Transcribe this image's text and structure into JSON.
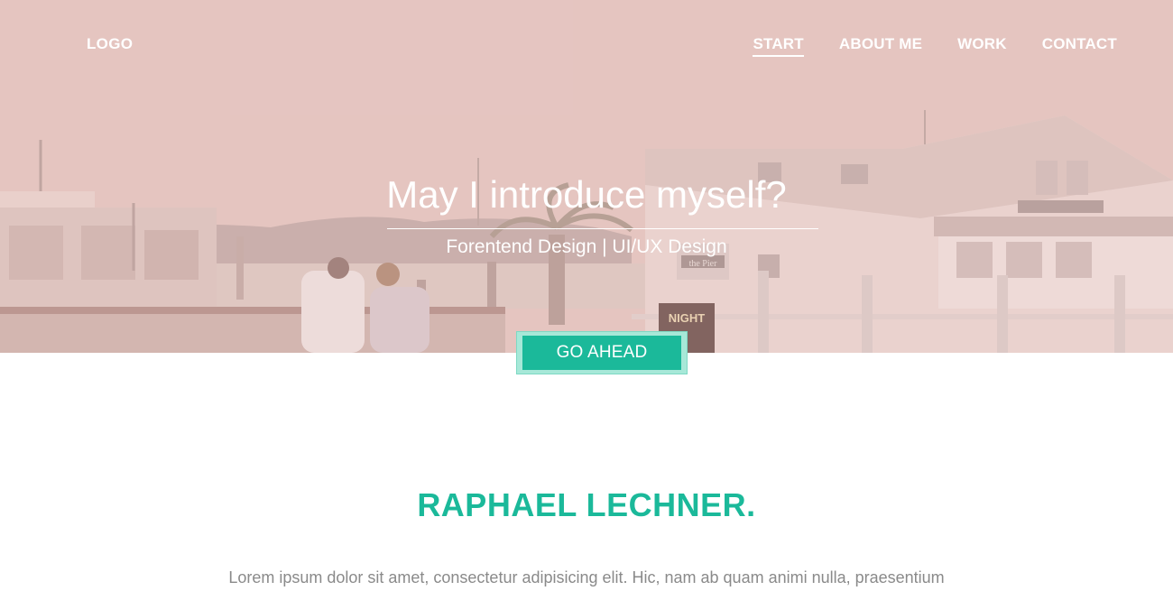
{
  "nav": {
    "logo": "LOGO",
    "items": [
      {
        "label": "START",
        "active": true
      },
      {
        "label": "ABOUT ME",
        "active": false
      },
      {
        "label": "WORK",
        "active": false
      },
      {
        "label": "CONTACT",
        "active": false
      }
    ]
  },
  "hero": {
    "title": "May I introduce myself?",
    "subtitle": "Forentend Design | UI/UX Design",
    "cta_label": "GO AHEAD",
    "image_scene": "harbor pier with couple sitting on a bench",
    "tint_color": "#e4c6c2",
    "sign_text": [
      "NIGHT",
      "the Pier"
    ]
  },
  "about": {
    "name": "RAPHAEL LECHNER.",
    "intro": "Lorem ipsum dolor sit amet, consectetur adipisicing elit. Hic, nam ab quam animi nulla, praesentium"
  },
  "colors": {
    "accent": "#1bb99a",
    "accent_light": "#a7e8d8",
    "text_muted": "#8a8a8a",
    "white": "#ffffff"
  }
}
